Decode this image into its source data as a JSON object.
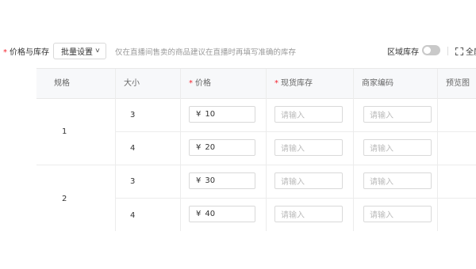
{
  "header": {
    "required_mark": "*",
    "section_label": "价格与库存",
    "batch_button_label": "批量设置",
    "hint": "仅在直播间售卖的商品建议在直播时再填写准确的库存",
    "region_stock_label": "区域库存",
    "region_stock_on": false,
    "fullscreen_label": "全屏"
  },
  "table": {
    "columns": [
      {
        "label": "规格",
        "required": false
      },
      {
        "label": "大小",
        "required": false
      },
      {
        "label": "价格",
        "required": true
      },
      {
        "label": "现货库存",
        "required": true
      },
      {
        "label": "商家编码",
        "required": false
      },
      {
        "label": "预览图",
        "required": false
      }
    ],
    "groups": [
      {
        "spec": "1",
        "rows": [
          {
            "size": "3",
            "price": "10",
            "stock_placeholder": "请输入",
            "code_placeholder": "请输入"
          },
          {
            "size": "4",
            "price": "20",
            "stock_placeholder": "请输入",
            "code_placeholder": "请输入"
          }
        ]
      },
      {
        "spec": "2",
        "rows": [
          {
            "size": "3",
            "price": "30",
            "stock_placeholder": "请输入",
            "code_placeholder": "请输入"
          },
          {
            "size": "4",
            "price": "40",
            "stock_placeholder": "请输入",
            "code_placeholder": "请输入"
          }
        ]
      }
    ],
    "currency_symbol": "¥"
  },
  "colors": {
    "required": "#f5222d",
    "toggle_off": "#c9c9c9",
    "header_bg": "#f7f8fa",
    "border": "#d9d9d9"
  }
}
